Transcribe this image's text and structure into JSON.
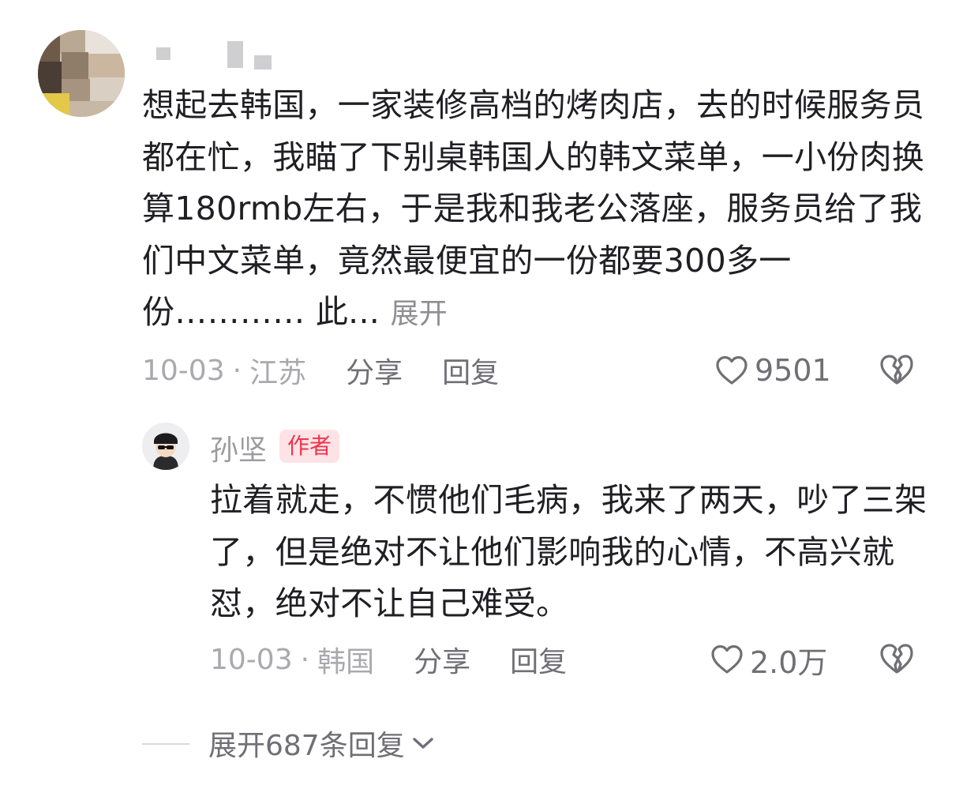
{
  "comment": {
    "text": "想起去韩国，一家装修高档的烤肉店，去的时候服务员都在忙，我瞄了下别桌韩国人的韩文菜单，一小份肉换算180rmb左右，于是我和我老公落座，服务员给了我们中文菜单，竟然最便宜的一份都要300多一份………… 此...",
    "expand_label": "展开",
    "date": "10-03",
    "separator": "·",
    "location": "江苏",
    "share_label": "分享",
    "reply_label": "回复",
    "likes": "9501",
    "avatar_icon": "blurred-avatar",
    "like_icon": "heart-outline-icon",
    "dislike_icon": "broken-heart-icon"
  },
  "reply": {
    "author": "孙坚",
    "badge": "作者",
    "text": "拉着就走，不惯他们毛病，我来了两天，吵了三架了，但是绝对不让他们影响我的心情，不高兴就怼，绝对不让自己难受。",
    "date": "10-03",
    "separator": "·",
    "location": "韩国",
    "share_label": "分享",
    "reply_label": "回复",
    "likes": "2.0万",
    "avatar_icon": "cartoon-avatar-icon",
    "like_icon": "heart-outline-icon",
    "dislike_icon": "broken-heart-icon"
  },
  "thread": {
    "expand_replies_label": "展开687条回复",
    "chevron_icon": "chevron-down-icon"
  },
  "colors": {
    "text_primary": "#1f1f24",
    "text_secondary": "#6f6f75",
    "text_muted": "#a9a9ae",
    "badge_bg": "#fde3e6",
    "badge_text": "#f0344a"
  }
}
